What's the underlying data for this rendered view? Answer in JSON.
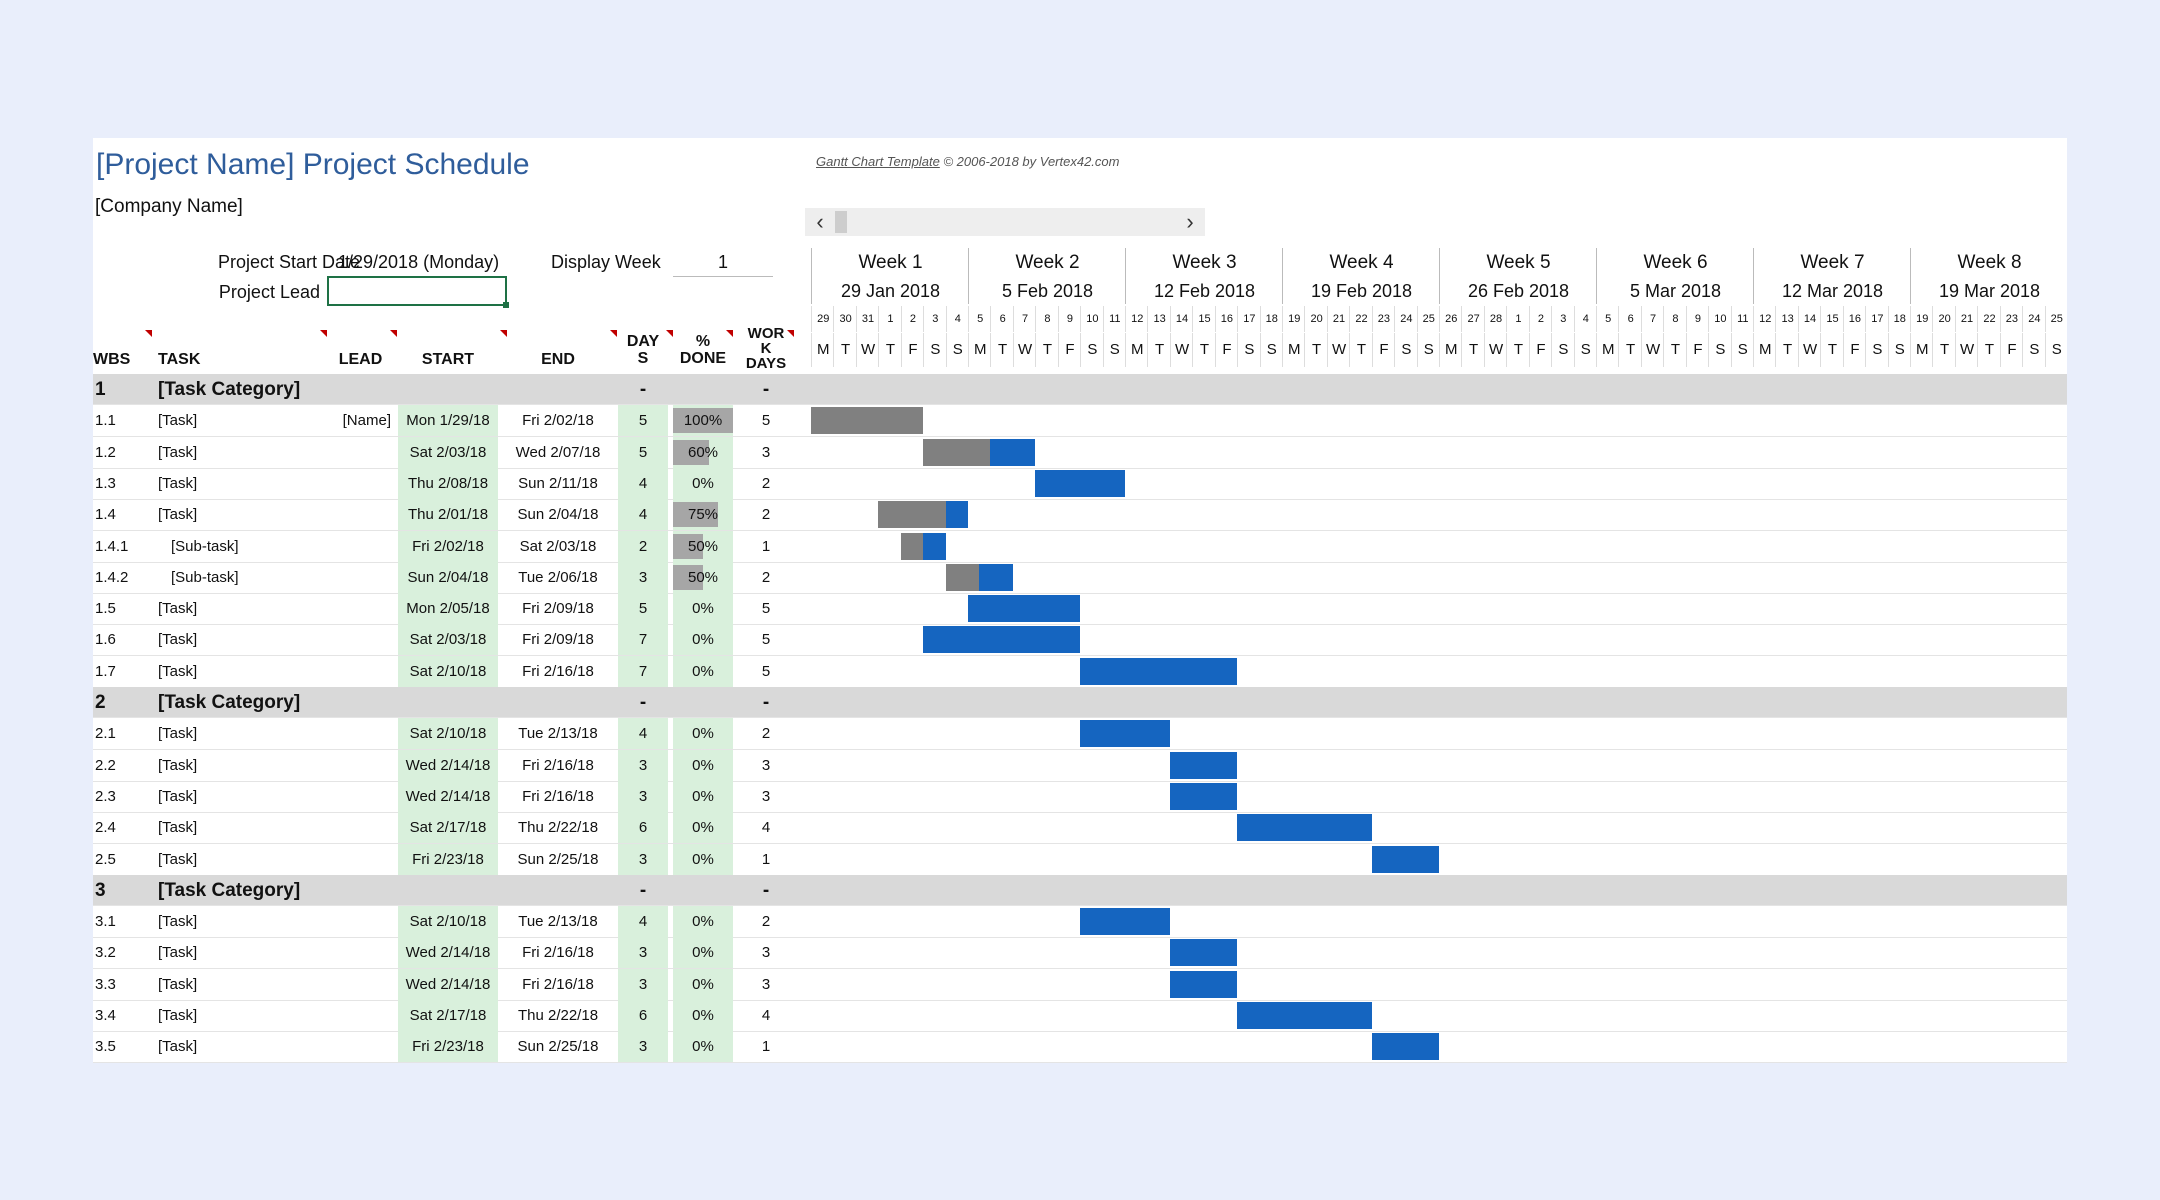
{
  "header": {
    "title": "[Project Name] Project Schedule",
    "company": "[Company Name]",
    "credit_link": "Gantt Chart Template",
    "credit_text": "© 2006-2018 by Vertex42.com",
    "start_date_label": "Project Start Date",
    "start_date_value": "1/29/2018 (Monday)",
    "display_week_label": "Display Week",
    "display_week_value": "1",
    "project_lead_label": "Project Lead",
    "project_lead_value": ""
  },
  "scroll": {
    "left": "‹",
    "right": "›"
  },
  "columns": {
    "wbs": "WBS",
    "task": "TASK",
    "lead": "LEAD",
    "start": "START",
    "end": "END",
    "days": "DAY\nS",
    "pct": "%\nDONE",
    "work": "WOR\nK\nDAYS"
  },
  "weeks": [
    {
      "label": "Week 1",
      "date": "29 Jan 2018"
    },
    {
      "label": "Week 2",
      "date": "5 Feb 2018"
    },
    {
      "label": "Week 3",
      "date": "12 Feb 2018"
    },
    {
      "label": "Week 4",
      "date": "19 Feb 2018"
    },
    {
      "label": "Week 5",
      "date": "26 Feb 2018"
    },
    {
      "label": "Week 6",
      "date": "5 Mar 2018"
    },
    {
      "label": "Week 7",
      "date": "12 Mar 2018"
    },
    {
      "label": "Week 8",
      "date": "19 Mar 2018"
    }
  ],
  "day_numbers": [
    "29",
    "30",
    "31",
    "1",
    "2",
    "3",
    "4",
    "5",
    "6",
    "7",
    "8",
    "9",
    "10",
    "11",
    "12",
    "13",
    "14",
    "15",
    "16",
    "17",
    "18",
    "19",
    "20",
    "21",
    "22",
    "23",
    "24",
    "25",
    "26",
    "27",
    "28",
    "1",
    "2",
    "3",
    "4",
    "5",
    "6",
    "7",
    "8",
    "9",
    "10",
    "11",
    "12",
    "13",
    "14",
    "15",
    "16",
    "17",
    "18",
    "19",
    "20",
    "21",
    "22",
    "23",
    "24",
    "25"
  ],
  "day_letters": [
    "M",
    "T",
    "W",
    "T",
    "F",
    "S",
    "S"
  ],
  "rows": [
    {
      "type": "cat",
      "wbs": "1",
      "task": "[Task Category]",
      "days": "-",
      "work": "-"
    },
    {
      "type": "task",
      "wbs": "1.1",
      "task": "[Task]",
      "lead": "[Name]",
      "start": "Mon 1/29/18",
      "end": "Fri 2/02/18",
      "days": "5",
      "pct": "100%",
      "pct_value": 1.0,
      "work": "5",
      "s": 0,
      "d": 5
    },
    {
      "type": "task",
      "wbs": "1.2",
      "task": "[Task]",
      "lead": "",
      "start": "Sat 2/03/18",
      "end": "Wed 2/07/18",
      "days": "5",
      "pct": "60%",
      "pct_value": 0.6,
      "work": "3",
      "s": 5,
      "d": 5
    },
    {
      "type": "task",
      "wbs": "1.3",
      "task": "[Task]",
      "lead": "",
      "start": "Thu 2/08/18",
      "end": "Sun 2/11/18",
      "days": "4",
      "pct": "0%",
      "pct_value": 0,
      "work": "2",
      "s": 10,
      "d": 4
    },
    {
      "type": "task",
      "wbs": "1.4",
      "task": "[Task]",
      "lead": "",
      "start": "Thu 2/01/18",
      "end": "Sun 2/04/18",
      "days": "4",
      "pct": "75%",
      "pct_value": 0.75,
      "work": "2",
      "s": 3,
      "d": 4
    },
    {
      "type": "task",
      "wbs": "1.4.1",
      "task": "[Sub-task]",
      "lead": "",
      "start": "Fri 2/02/18",
      "end": "Sat 2/03/18",
      "days": "2",
      "pct": "50%",
      "pct_value": 0.5,
      "work": "1",
      "s": 4,
      "d": 2,
      "indent": true
    },
    {
      "type": "task",
      "wbs": "1.4.2",
      "task": "[Sub-task]",
      "lead": "",
      "start": "Sun 2/04/18",
      "end": "Tue 2/06/18",
      "days": "3",
      "pct": "50%",
      "pct_value": 0.5,
      "work": "2",
      "s": 6,
      "d": 3,
      "indent": true
    },
    {
      "type": "task",
      "wbs": "1.5",
      "task": "[Task]",
      "lead": "",
      "start": "Mon 2/05/18",
      "end": "Fri 2/09/18",
      "days": "5",
      "pct": "0%",
      "pct_value": 0,
      "work": "5",
      "s": 7,
      "d": 5
    },
    {
      "type": "task",
      "wbs": "1.6",
      "task": "[Task]",
      "lead": "",
      "start": "Sat 2/03/18",
      "end": "Fri 2/09/18",
      "days": "7",
      "pct": "0%",
      "pct_value": 0,
      "work": "5",
      "s": 5,
      "d": 7
    },
    {
      "type": "task",
      "wbs": "1.7",
      "task": "[Task]",
      "lead": "",
      "start": "Sat 2/10/18",
      "end": "Fri 2/16/18",
      "days": "7",
      "pct": "0%",
      "pct_value": 0,
      "work": "5",
      "s": 12,
      "d": 7
    },
    {
      "type": "cat",
      "wbs": "2",
      "task": "[Task Category]",
      "days": "-",
      "work": "-"
    },
    {
      "type": "task",
      "wbs": "2.1",
      "task": "[Task]",
      "lead": "",
      "start": "Sat 2/10/18",
      "end": "Tue 2/13/18",
      "days": "4",
      "pct": "0%",
      "pct_value": 0,
      "work": "2",
      "s": 12,
      "d": 4
    },
    {
      "type": "task",
      "wbs": "2.2",
      "task": "[Task]",
      "lead": "",
      "start": "Wed 2/14/18",
      "end": "Fri 2/16/18",
      "days": "3",
      "pct": "0%",
      "pct_value": 0,
      "work": "3",
      "s": 16,
      "d": 3
    },
    {
      "type": "task",
      "wbs": "2.3",
      "task": "[Task]",
      "lead": "",
      "start": "Wed 2/14/18",
      "end": "Fri 2/16/18",
      "days": "3",
      "pct": "0%",
      "pct_value": 0,
      "work": "3",
      "s": 16,
      "d": 3
    },
    {
      "type": "task",
      "wbs": "2.4",
      "task": "[Task]",
      "lead": "",
      "start": "Sat 2/17/18",
      "end": "Thu 2/22/18",
      "days": "6",
      "pct": "0%",
      "pct_value": 0,
      "work": "4",
      "s": 19,
      "d": 6
    },
    {
      "type": "task",
      "wbs": "2.5",
      "task": "[Task]",
      "lead": "",
      "start": "Fri 2/23/18",
      "end": "Sun 2/25/18",
      "days": "3",
      "pct": "0%",
      "pct_value": 0,
      "work": "1",
      "s": 25,
      "d": 3
    },
    {
      "type": "cat",
      "wbs": "3",
      "task": "[Task Category]",
      "days": "-",
      "work": "-"
    },
    {
      "type": "task",
      "wbs": "3.1",
      "task": "[Task]",
      "lead": "",
      "start": "Sat 2/10/18",
      "end": "Tue 2/13/18",
      "days": "4",
      "pct": "0%",
      "pct_value": 0,
      "work": "2",
      "s": 12,
      "d": 4
    },
    {
      "type": "task",
      "wbs": "3.2",
      "task": "[Task]",
      "lead": "",
      "start": "Wed 2/14/18",
      "end": "Fri 2/16/18",
      "days": "3",
      "pct": "0%",
      "pct_value": 0,
      "work": "3",
      "s": 16,
      "d": 3
    },
    {
      "type": "task",
      "wbs": "3.3",
      "task": "[Task]",
      "lead": "",
      "start": "Wed 2/14/18",
      "end": "Fri 2/16/18",
      "days": "3",
      "pct": "0%",
      "pct_value": 0,
      "work": "3",
      "s": 16,
      "d": 3
    },
    {
      "type": "task",
      "wbs": "3.4",
      "task": "[Task]",
      "lead": "",
      "start": "Sat 2/17/18",
      "end": "Thu 2/22/18",
      "days": "6",
      "pct": "0%",
      "pct_value": 0,
      "work": "4",
      "s": 19,
      "d": 6
    },
    {
      "type": "task",
      "wbs": "3.5",
      "task": "[Task]",
      "lead": "",
      "start": "Fri 2/23/18",
      "end": "Sun 2/25/18",
      "days": "3",
      "pct": "0%",
      "pct_value": 0,
      "work": "1",
      "s": 25,
      "d": 3
    }
  ],
  "colors": {
    "title": "#2f5d9b",
    "bar_done": "#808080",
    "bar_todo": "#1565c0",
    "green_cell": "#d9f0dc",
    "category_row": "#d9d9d9"
  }
}
